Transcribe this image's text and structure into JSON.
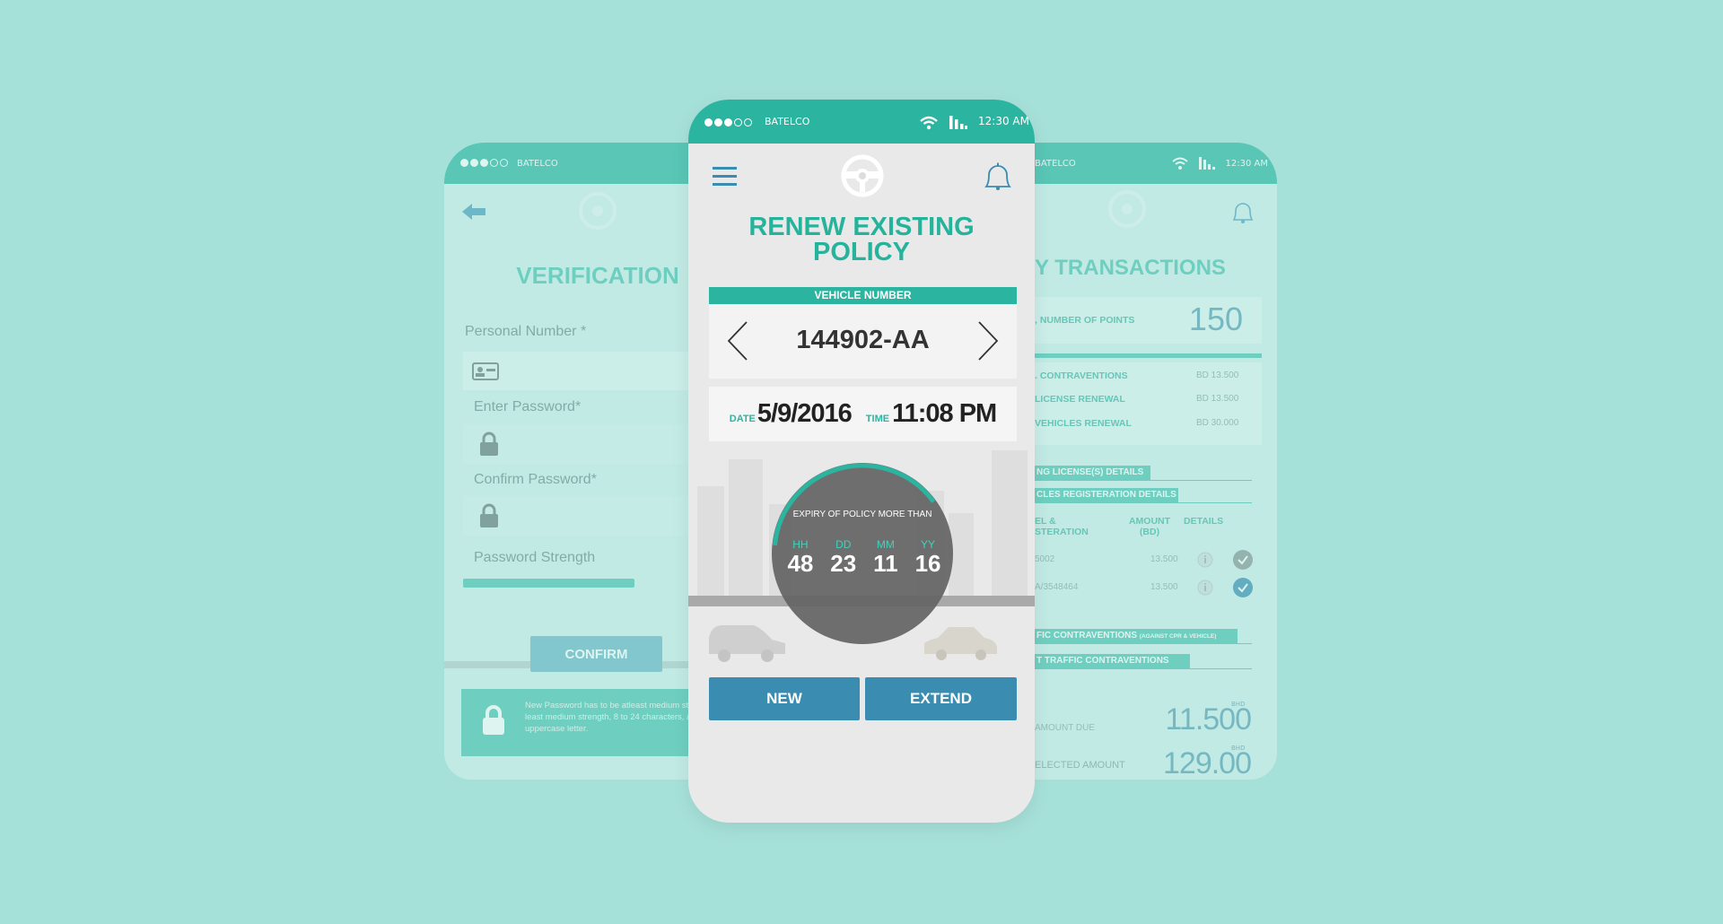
{
  "colors": {
    "background": "#a6e1d9",
    "accent": "#2bb5a0",
    "button": "#3a8db0",
    "dial": "#6e6e6e"
  },
  "status_bar": {
    "carrier": "BATELCO",
    "time": "12:30 AM",
    "icons": [
      "signal-dots-icon",
      "wifi-icon",
      "signal-bars-icon"
    ]
  },
  "left_screen": {
    "title": "VERIFICATION",
    "fields": [
      {
        "label": "Personal Number *",
        "icon": "id-card-icon",
        "value": ""
      },
      {
        "label": "Enter Password*",
        "icon": "lock-icon",
        "value": ""
      },
      {
        "label": "Confirm Password*",
        "icon": "lock-icon",
        "value": ""
      }
    ],
    "strength_label": "Password Strength",
    "strength_percent": 52,
    "confirm_label": "CONFIRM",
    "info_text": "New Password has to be atleast medium strength, 8 to 24  character at least medium strength, 8 to 24 characters, at least one and one uppercase letter."
  },
  "center_screen": {
    "title_line1": "RENEW EXISTING",
    "title_line2": "POLICY",
    "vehicle_label": "VEHICLE NUMBER",
    "vehicle_number": "144902-AA",
    "date_label": "DATE",
    "date": "5/9/2016",
    "time_label": "TIME",
    "time": "11:08 PM",
    "expiry_title": "EXPIRY OF POLICY MORE THAN",
    "expiry": [
      {
        "unit": "HH",
        "value": "48"
      },
      {
        "unit": "DD",
        "value": "23"
      },
      {
        "unit": "MM",
        "value": "11"
      },
      {
        "unit": "YY",
        "value": "16"
      }
    ],
    "new_label": "NEW",
    "extend_label": "EXTEND"
  },
  "right_screen": {
    "title": "Y TRANSACTIONS",
    "points_label": ", NUMBER OF POINTS",
    "points": "150",
    "summary": [
      {
        "label": ". CONTRAVENTIONS",
        "amount": "BD 13.500"
      },
      {
        "label": "LICENSE RENEWAL",
        "amount": "BD 13.500"
      },
      {
        "label": "VEHICLES RENEWAL",
        "amount": "BD 30.000"
      }
    ],
    "section1": "NG LICENSE(S) DETAILS",
    "section2": "CLES REGISTERATION DETAILS",
    "col1_line1": "EL &",
    "col1_line2": "STERATION",
    "col2": "AMOUNT",
    "col2_unit": "(BD)",
    "col3": "DETAILS",
    "rows": [
      {
        "id": "5002",
        "amount": "13.500",
        "checked": false
      },
      {
        "id": "A/3548464",
        "amount": "13.500",
        "checked": true
      }
    ],
    "section3": "FIC CONTRAVENTIONS",
    "section3_note": "(AGAINST CPR & VEHICLE)",
    "section4": "T TRAFFIC CONTRAVENTIONS",
    "currency": "BHD",
    "due_label": "AMOUNT DUE",
    "due": "11.500",
    "selected_label": "ELECTED AMOUNT",
    "selected": "129.00"
  }
}
